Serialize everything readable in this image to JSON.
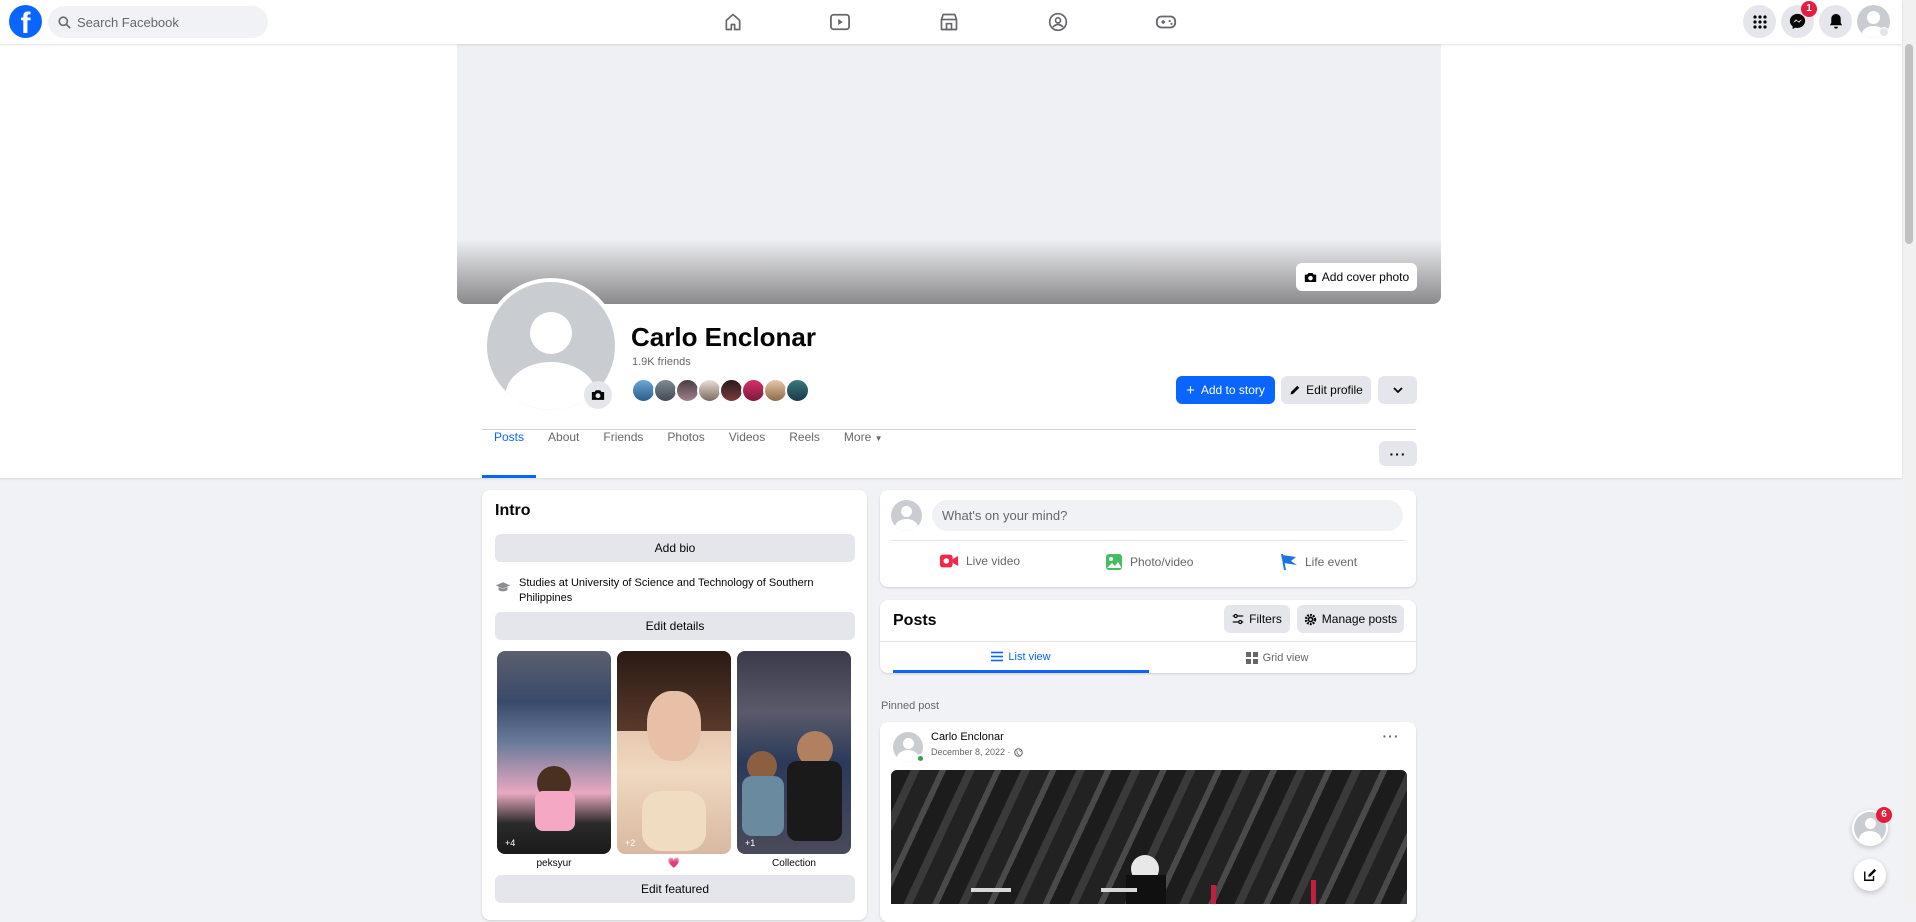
{
  "topbar": {
    "logo": "f",
    "search_placeholder": "Search Facebook",
    "nav_icons": [
      "home-icon",
      "watch-icon",
      "marketplace-icon",
      "groups-icon",
      "gaming-icon"
    ],
    "messenger_badge": "1",
    "chat_badge": "6"
  },
  "cover": {
    "add_cover_label": "Add cover photo"
  },
  "profile": {
    "name": "Carlo Enclonar",
    "friends_count": "1.9K friends",
    "add_story_label": "Add to story",
    "edit_profile_label": "Edit profile"
  },
  "tabs": [
    {
      "label": "Posts",
      "active": true
    },
    {
      "label": "About"
    },
    {
      "label": "Friends"
    },
    {
      "label": "Photos"
    },
    {
      "label": "Videos"
    },
    {
      "label": "Reels"
    },
    {
      "label": "More"
    }
  ],
  "intro": {
    "title": "Intro",
    "add_bio_label": "Add bio",
    "study_text": "Studies at University of Science and Technology of Southern Philippines",
    "edit_details_label": "Edit details",
    "featured": [
      {
        "count": "+4",
        "label": "peksyur"
      },
      {
        "count": "+2",
        "label": "💗"
      },
      {
        "count": "+1",
        "label": "Collection"
      }
    ],
    "edit_featured_label": "Edit featured"
  },
  "composer": {
    "placeholder": "What's on your mind?",
    "actions": [
      "Live video",
      "Photo/video",
      "Life event"
    ]
  },
  "posts_card": {
    "title": "Posts",
    "filters_label": "Filters",
    "manage_label": "Manage posts",
    "list_view_label": "List view",
    "grid_view_label": "Grid view"
  },
  "pinned": {
    "label": "Pinned post",
    "author": "Carlo Enclonar",
    "date": "December 8, 2022 ·"
  },
  "colors": {
    "brand": "#0866ff",
    "badge": "#e41e3f"
  }
}
